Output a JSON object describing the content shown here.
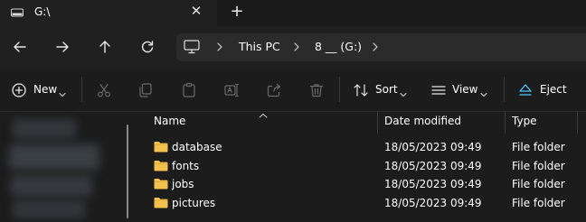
{
  "tab": {
    "title": "G:\\",
    "icon": "drive-icon",
    "close_icon": "close-icon",
    "new_tab_icon": "plus-icon"
  },
  "navigation": {
    "back_icon": "arrow-left-icon",
    "forward_icon": "arrow-right-icon",
    "up_icon": "arrow-up-icon",
    "refresh_icon": "refresh-icon"
  },
  "address": {
    "root_icon": "monitor-icon",
    "breadcrumbs": [
      "This PC",
      "8 __ (G:)"
    ]
  },
  "toolbar": {
    "new_label": "New",
    "sort_label": "Sort",
    "view_label": "View",
    "eject_label": "Eject",
    "icons": [
      "plus-circle-icon",
      "cut-icon",
      "copy-icon",
      "paste-icon",
      "rename-icon",
      "share-icon",
      "delete-icon",
      "sort-icon",
      "view-icon",
      "eject-icon"
    ]
  },
  "columns": {
    "name": "Name",
    "date_modified": "Date modified",
    "type": "Type"
  },
  "files": [
    {
      "name": "database",
      "date": "18/05/2023 09:49",
      "type": "File folder"
    },
    {
      "name": "fonts",
      "date": "18/05/2023 09:49",
      "type": "File folder"
    },
    {
      "name": "jobs",
      "date": "18/05/2023 09:49",
      "type": "File folder"
    },
    {
      "name": "pictures",
      "date": "18/05/2023 09:49",
      "type": "File folder"
    }
  ],
  "colors": {
    "folder": "#f2c14e",
    "accent": "#4cc2ff",
    "background": "#1c1c1c"
  }
}
